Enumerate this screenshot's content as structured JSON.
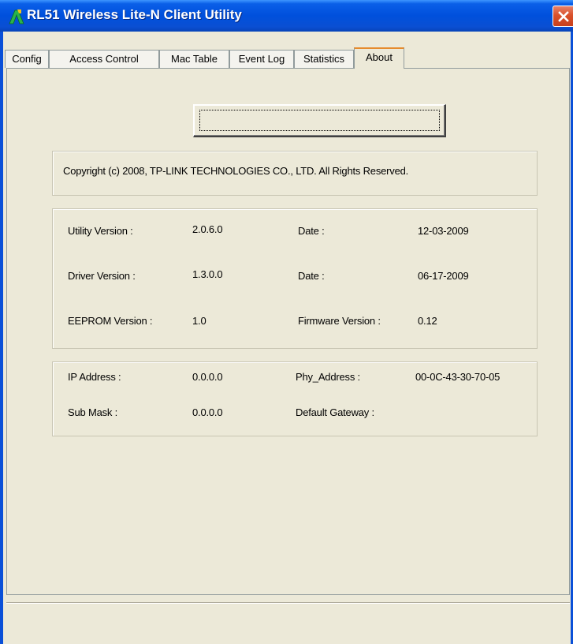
{
  "window": {
    "title": "RL51 Wireless Lite-N Client Utility"
  },
  "tabs": [
    {
      "label": "Config"
    },
    {
      "label": "Access Control"
    },
    {
      "label": "Mac Table"
    },
    {
      "label": "Event Log"
    },
    {
      "label": "Statistics"
    },
    {
      "label": "About"
    }
  ],
  "active_tab": "About",
  "about": {
    "blank_button_label": "",
    "copyright": "Copyright (c) 2008, TP-LINK TECHNOLOGIES CO., LTD. All Rights Reserved.",
    "versions": {
      "utility_label": "Utility Version :",
      "utility_value": "2.0.6.0",
      "utility_date_label": "Date :",
      "utility_date_value": "12-03-2009",
      "driver_label": "Driver Version :",
      "driver_value": "1.3.0.0",
      "driver_date_label": "Date :",
      "driver_date_value": "06-17-2009",
      "eeprom_label": "EEPROM Version :",
      "eeprom_value": "1.0",
      "firmware_label": "Firmware Version :",
      "firmware_value": "0.12"
    },
    "network": {
      "ip_label": "IP Address :",
      "ip_value": "0.0.0.0",
      "phy_label": "Phy_Address :",
      "phy_value": "00-0C-43-30-70-05",
      "mask_label": "Sub Mask :",
      "mask_value": "0.0.0.0",
      "gateway_label": "Default Gateway :",
      "gateway_value": ""
    }
  },
  "icons": {
    "app": "tp-link-app-icon",
    "close": "close-icon"
  },
  "colors": {
    "titlebar": "#0050dc",
    "close_button": "#d9512b",
    "active_tab_accent": "#e68b2c",
    "face": "#ece9d8"
  }
}
